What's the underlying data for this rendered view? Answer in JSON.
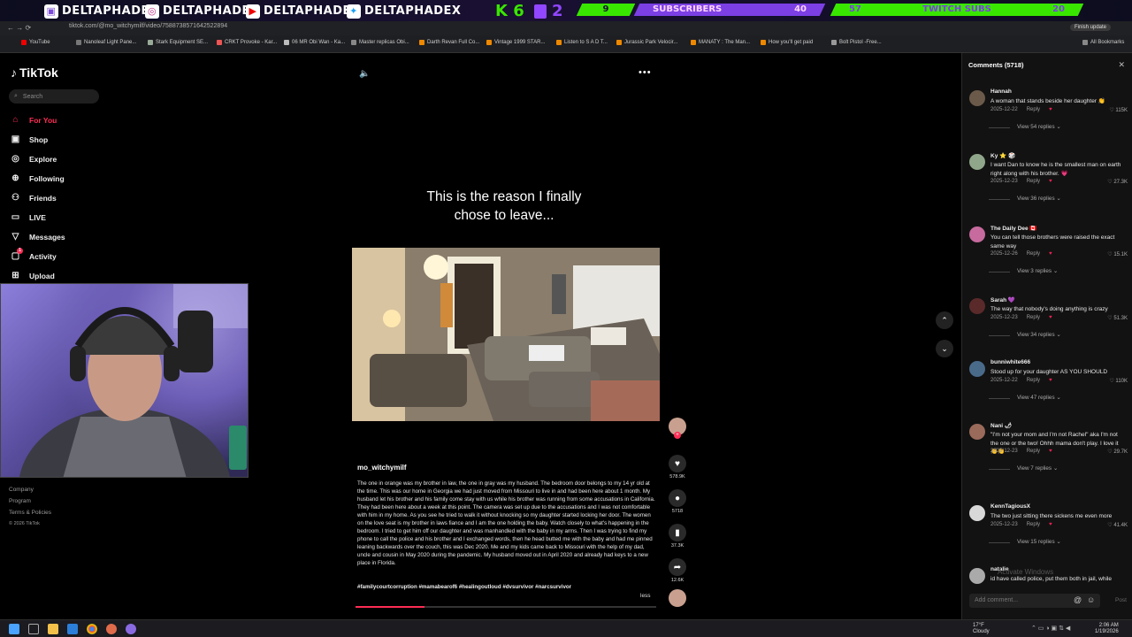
{
  "stream": {
    "handles": [
      "DELTAPHADE",
      "DELTAPHADE",
      "DELTAPHADE",
      "DELTAPHADEX"
    ],
    "kb_text": "K 6",
    "kb_num": "2",
    "subs_count": "9",
    "subs_label": "SUBSCRIBERS",
    "subs_goal": "40",
    "twitch_count": "57",
    "twitch_label": "TWITCH SUBS",
    "twitch_goal": "20"
  },
  "browser": {
    "url": "tiktok.com/@mo_witchymilf/video/7588738571642522894",
    "bookmarks": [
      "YouTube",
      "Nanoleaf Light Pane...",
      "Stark Equipment SE...",
      "CRKT Provoke - Kar...",
      "06 MR Obi Wan - Ka...",
      "Master replicas Obi...",
      "Darth Revan Full Co...",
      "Vintage 1999 STAR...",
      "Listen to S A D T...",
      "Jurassic Park Velocir...",
      "MANATY : The Man...",
      "How you'll get paid",
      "Bolt Pistol -Free..."
    ],
    "all_bookmarks": "All Bookmarks",
    "finish_update": "Finish update"
  },
  "sidebar": {
    "logo": "TikTok",
    "search_placeholder": "Search",
    "nav": [
      "For You",
      "Shop",
      "Explore",
      "Following",
      "Friends",
      "LIVE",
      "Messages",
      "Activity",
      "Upload"
    ],
    "activity_badge": "1",
    "footer": [
      "Company",
      "Program",
      "Terms & Policies",
      "© 2026 TikTok"
    ]
  },
  "video": {
    "title_line1": "This is the reason I finally",
    "title_line2": "chose to leave...",
    "author": "mo_witchymilf",
    "description": "The one in orange was my brother in law, the one in gray was my husband. The bedroom door belongs to my 14 yr old at the time. This was our home in Georgia we had just moved from Missouri to live in and had been here about 1 month. My husband let his brother and his family come stay with us while his brother was running from some accusations in California. They had been here about a week at this point. The camera was set up due to the accusations and I was not comfortable with him in my home. As you see he tried to walk it without knocking so my daughter started locking her door. The women on the love seat is my brother in laws fiance and I am the one holding the baby. Watch closely to what's happening in the bedroom. I tried to get him off our daughter and was manhandled with the baby in my arms. Then I was trying to find my phone to call the police and his brother and I exchanged words, then he head butted me with the baby and had me pinned leaning backwards over the couch, this was Dec 2020. Me and my kids came back to Missouri with the help of my dad, uncle and cousin in May 2020 during the pandemic. My husband moved out in April 2020 and already had keys to a new place in Florida.",
    "hashtags": "#familycourtcorruption #mamabearof6 #healingoutloud #dvsurvivor #narcsurvivor",
    "less": "less",
    "progress_fraction": 0.23,
    "likes": "578.9K",
    "comments": "5718",
    "saves": "37.3K",
    "shares": "12.6K"
  },
  "comments_panel": {
    "title": "Comments (5718)",
    "input_placeholder": "Add comment...",
    "post_label": "Post",
    "items": [
      {
        "name": "Hannah",
        "text": "A woman that stands beside her daughter 👏",
        "date": "2025-12-22",
        "reply": "Reply",
        "likes": "115K",
        "replies": "View 54 replies",
        "color": "#6b5a4a"
      },
      {
        "name": "Ky ⭐ 🎲",
        "text": "I want Dan to know he is the smallest man on earth right along with his brother. 💗",
        "date": "2025-12-23",
        "reply": "Reply",
        "likes": "27.3K",
        "replies": "View 36 replies",
        "color": "#8fa68a"
      },
      {
        "name": "The Daily Dee 🇨🇦",
        "text": "You can tell those brothers were raised the exact same way",
        "date": "2025-12-26",
        "reply": "Reply",
        "likes": "15.1K",
        "replies": "View 3 replies",
        "color": "#c76a9e"
      },
      {
        "name": "Sarah 💜",
        "text": "The way that nobody's doing anything is crazy",
        "date": "2025-12-23",
        "reply": "Reply",
        "likes": "51.3K",
        "replies": "View 34 replies",
        "color": "#5a2a2a"
      },
      {
        "name": "bunniwhite666",
        "text": "Stood up for your daughter AS YOU SHOULD",
        "date": "2025-12-22",
        "reply": "Reply",
        "likes": "110K",
        "replies": "View 47 replies",
        "color": "#4a6a8a"
      },
      {
        "name": "Nani 🌶",
        "text": "\"I'm not your mom and I'm not Rachel\" aka I'm not the one or the two! Ohhh mama don't play. I love it 👏👏",
        "date": "2025-12-23",
        "reply": "Reply",
        "likes": "29.7K",
        "replies": "View 7 replies",
        "color": "#9a6a5a"
      },
      {
        "name": "KennTagiousX",
        "text": "The two just sitting there sickens me even more",
        "date": "2025-12-23",
        "reply": "Reply",
        "likes": "41.4K",
        "replies": "View 15 replies",
        "color": "#d8d8d8"
      },
      {
        "name": "natalie",
        "text": "id have called police, put them both in jail, while",
        "date": "",
        "reply": "",
        "likes": "",
        "replies": "",
        "color": "#aaa"
      }
    ],
    "watermark": "Activate Windows"
  },
  "taskbar": {
    "weather_temp": "17°F",
    "weather_desc": "Cloudy",
    "time": "2:06 AM",
    "date": "1/19/2026"
  }
}
